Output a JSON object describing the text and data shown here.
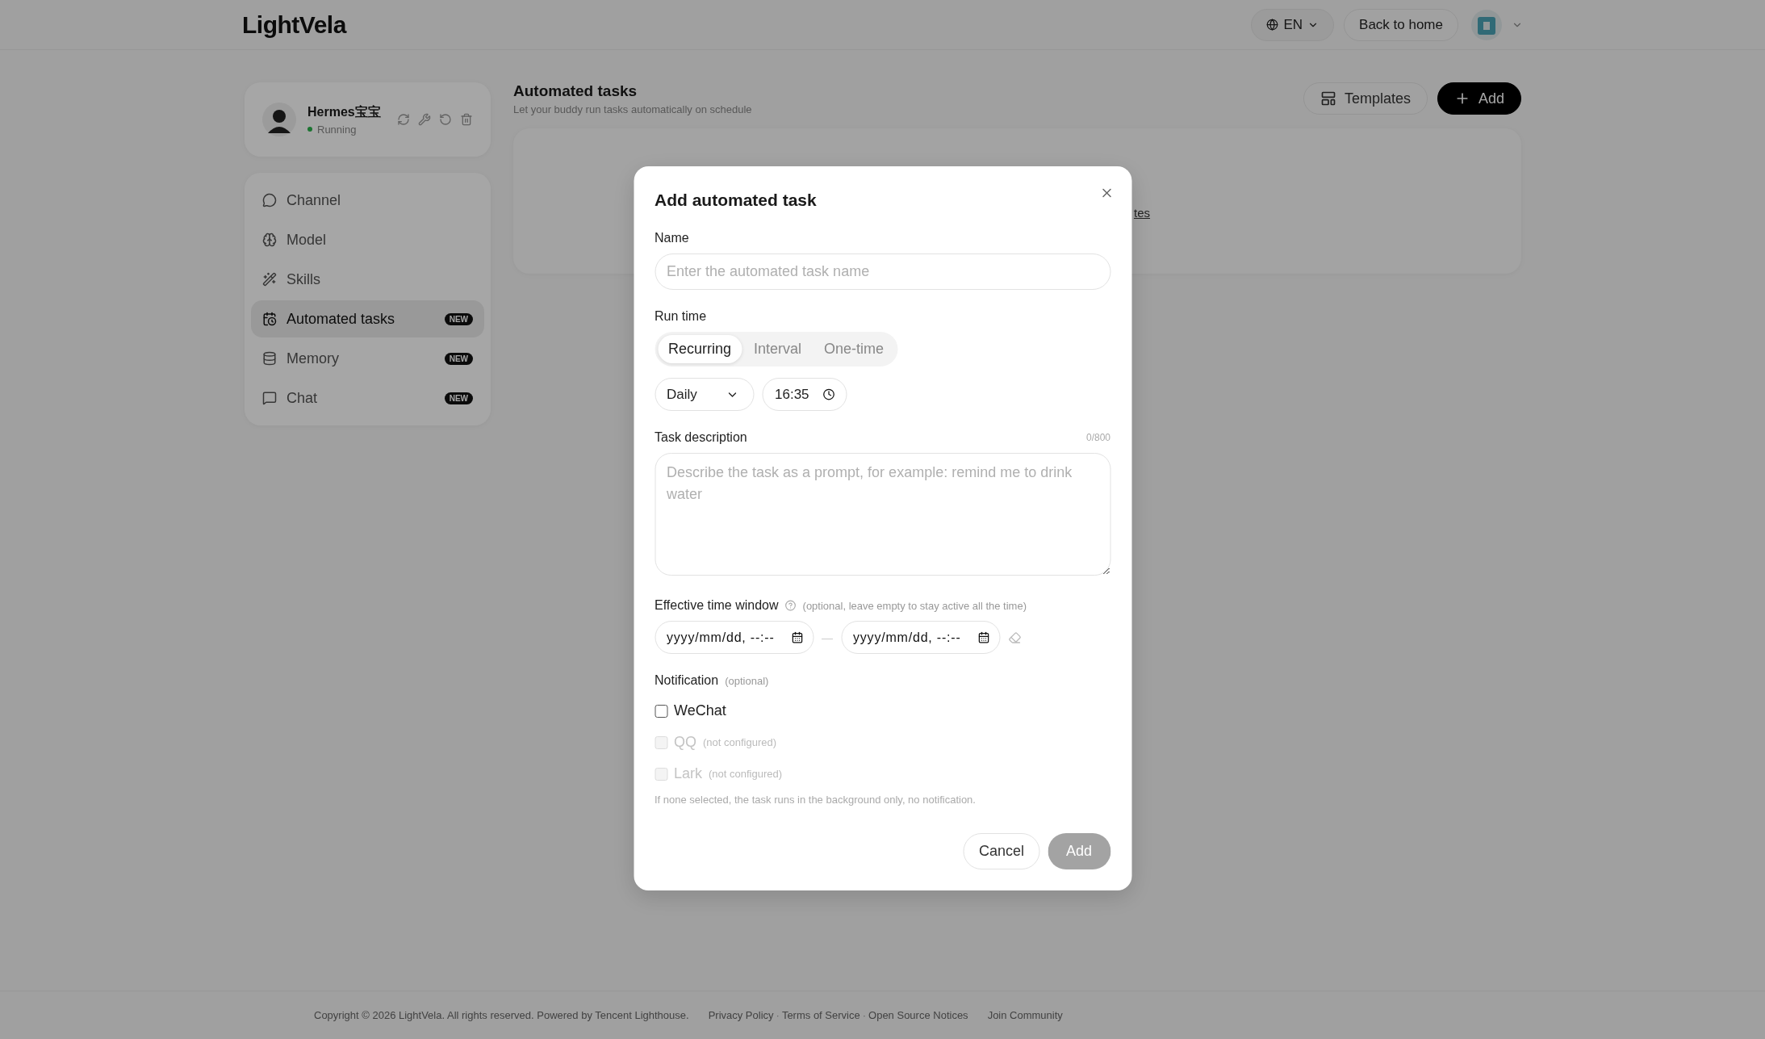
{
  "header": {
    "logo": "LightVela",
    "language": "EN",
    "back_button": "Back to home"
  },
  "profile": {
    "name": "Hermes宝宝",
    "status": "Running",
    "running": true
  },
  "sidebar": {
    "items": [
      {
        "label": "Channel",
        "selected": false
      },
      {
        "label": "Model",
        "selected": false
      },
      {
        "label": "Skills",
        "selected": false
      },
      {
        "label": "Automated tasks",
        "selected": true,
        "badge": "NEW"
      },
      {
        "label": "Memory",
        "selected": false,
        "badge": "NEW"
      },
      {
        "label": "Chat",
        "selected": false,
        "badge": "NEW"
      }
    ]
  },
  "main": {
    "title": "Automated tasks",
    "subtitle": "Let your buddy run tasks automatically on schedule",
    "templates_button": "Templates",
    "add_button": "Add",
    "empty_link_fragment": "tes"
  },
  "dialog": {
    "title": "Add automated task",
    "name_field": {
      "label": "Name",
      "placeholder": "Enter the automated task name"
    },
    "run_time": {
      "label": "Run time",
      "modes": [
        {
          "label": "Recurring",
          "selected": true
        },
        {
          "label": "Interval",
          "selected": false
        },
        {
          "label": "One-time",
          "selected": false
        }
      ],
      "frequency": "Daily",
      "time": "16:35"
    },
    "description": {
      "label": "Task description",
      "counter": "0/800",
      "placeholder": "Describe the task as a prompt, for example: remind me to drink water"
    },
    "time_window": {
      "label": "Effective time window",
      "hint": "(optional, leave empty to stay active all the time)",
      "start": "yyyy/mm/dd, --:--",
      "separator": "—",
      "end": "yyyy/mm/dd, --:--"
    },
    "notification": {
      "label": "Notification",
      "hint": "(optional)",
      "channels": [
        {
          "label": "WeChat",
          "checked": false,
          "disabled": false
        },
        {
          "label": "QQ",
          "checked": false,
          "disabled": true,
          "note": "(not configured)"
        },
        {
          "label": "Lark",
          "checked": false,
          "disabled": true,
          "note": "(not configured)"
        }
      ],
      "footnote": "If none selected, the task runs in the background only, no notification."
    },
    "cancel_button": "Cancel",
    "submit_button": {
      "label": "Add",
      "disabled": true
    }
  },
  "footer": {
    "copyright": "Copyright © 2026 LightVela. All rights reserved. Powered by Tencent Lighthouse.",
    "links": [
      {
        "kind": "link",
        "label": "Privacy Policy"
      },
      {
        "kind": "separator",
        "label": "·"
      },
      {
        "kind": "link",
        "label": "Terms of Service"
      },
      {
        "kind": "separator",
        "label": "·"
      },
      {
        "kind": "link",
        "label": "Open Source Notices"
      }
    ],
    "community": "Join Community"
  }
}
